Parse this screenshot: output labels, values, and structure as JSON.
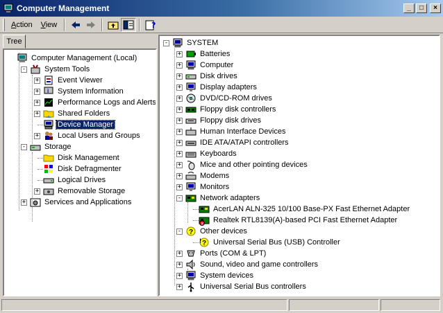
{
  "window": {
    "title": "Computer Management",
    "controls": {
      "minimize": "_",
      "maximize": "□",
      "close": "×"
    }
  },
  "toolbar": {
    "action_label": "Action",
    "view_label": "View",
    "icons": [
      "back-arrow-icon",
      "forward-arrow-icon",
      "up-folder-icon",
      "show-hide-tree-icon",
      "help-icon"
    ]
  },
  "tabs": {
    "tree_label": "Tree"
  },
  "left_tree": [
    {
      "label": "Computer Management (Local)",
      "icon": "computer-mgmt-icon",
      "expander": "",
      "selected": false
    },
    {
      "label": "System Tools",
      "icon": "tools-icon",
      "expander": "-",
      "selected": false
    },
    {
      "label": "Event Viewer",
      "icon": "event-viewer-icon",
      "expander": "+",
      "selected": false
    },
    {
      "label": "System Information",
      "icon": "info-icon",
      "expander": "+",
      "selected": false
    },
    {
      "label": "Performance Logs and Alerts",
      "icon": "performance-icon",
      "expander": "+",
      "selected": false
    },
    {
      "label": "Shared Folders",
      "icon": "shared-folder-icon",
      "expander": "+",
      "selected": false
    },
    {
      "label": "Device Manager",
      "icon": "device-manager-icon",
      "expander": "",
      "selected": true
    },
    {
      "label": "Local Users and Groups",
      "icon": "users-icon",
      "expander": "+",
      "selected": false
    },
    {
      "label": "Storage",
      "icon": "storage-icon",
      "expander": "-",
      "selected": false
    },
    {
      "label": "Disk Management",
      "icon": "disk-mgmt-icon",
      "expander": "",
      "selected": false
    },
    {
      "label": "Disk Defragmenter",
      "icon": "defrag-icon",
      "expander": "",
      "selected": false
    },
    {
      "label": "Logical Drives",
      "icon": "logical-drive-icon",
      "expander": "",
      "selected": false
    },
    {
      "label": "Removable Storage",
      "icon": "removable-storage-icon",
      "expander": "+",
      "selected": false
    },
    {
      "label": "Services and Applications",
      "icon": "services-icon",
      "expander": "+",
      "selected": false
    }
  ],
  "device_tree": [
    {
      "label": "SYSTEM",
      "icon": "computer-icon",
      "expander": "-"
    },
    {
      "label": "Batteries",
      "icon": "battery-icon",
      "expander": "+"
    },
    {
      "label": "Computer",
      "icon": "computer-icon",
      "expander": "+"
    },
    {
      "label": "Disk drives",
      "icon": "disk-drive-icon",
      "expander": "+"
    },
    {
      "label": "Display adapters",
      "icon": "monitor-icon",
      "expander": "+"
    },
    {
      "label": "DVD/CD-ROM drives",
      "icon": "cdrom-icon",
      "expander": "+"
    },
    {
      "label": "Floppy disk controllers",
      "icon": "controller-icon",
      "expander": "+"
    },
    {
      "label": "Floppy disk drives",
      "icon": "floppy-icon",
      "expander": "+"
    },
    {
      "label": "Human Interface Devices",
      "icon": "hid-icon",
      "expander": "+"
    },
    {
      "label": "IDE ATA/ATAPI controllers",
      "icon": "ide-icon",
      "expander": "+"
    },
    {
      "label": "Keyboards",
      "icon": "keyboard-icon",
      "expander": "+"
    },
    {
      "label": "Mice and other pointing devices",
      "icon": "mouse-icon",
      "expander": "+"
    },
    {
      "label": "Modems",
      "icon": "modem-icon",
      "expander": "+"
    },
    {
      "label": "Monitors",
      "icon": "monitor-icon",
      "expander": "+"
    },
    {
      "label": "Network adapters",
      "icon": "network-card-icon",
      "expander": "-"
    },
    {
      "label": "AcerLAN ALN-325 10/100 Base-PX Fast Ethernet Adapter",
      "icon": "network-card-icon",
      "expander": ""
    },
    {
      "label": "Realtek RTL8139(A)-based PCI Fast Ethernet Adapter",
      "icon": "network-card-warning-icon",
      "expander": ""
    },
    {
      "label": "Other devices",
      "icon": "question-icon",
      "expander": "-"
    },
    {
      "label": "Universal Serial Bus (USB) Controller",
      "icon": "question-warning-icon",
      "expander": ""
    },
    {
      "label": "Ports (COM & LPT)",
      "icon": "port-icon",
      "expander": "+"
    },
    {
      "label": "Sound, video and game controllers",
      "icon": "sound-icon",
      "expander": "+"
    },
    {
      "label": "System devices",
      "icon": "computer-icon",
      "expander": "+"
    },
    {
      "label": "Universal Serial Bus controllers",
      "icon": "usb-icon",
      "expander": "+"
    }
  ],
  "colors": {
    "title_start": "#0a246a",
    "title_end": "#a6caf0",
    "selection": "#0a246a",
    "face": "#d4d0c8"
  }
}
